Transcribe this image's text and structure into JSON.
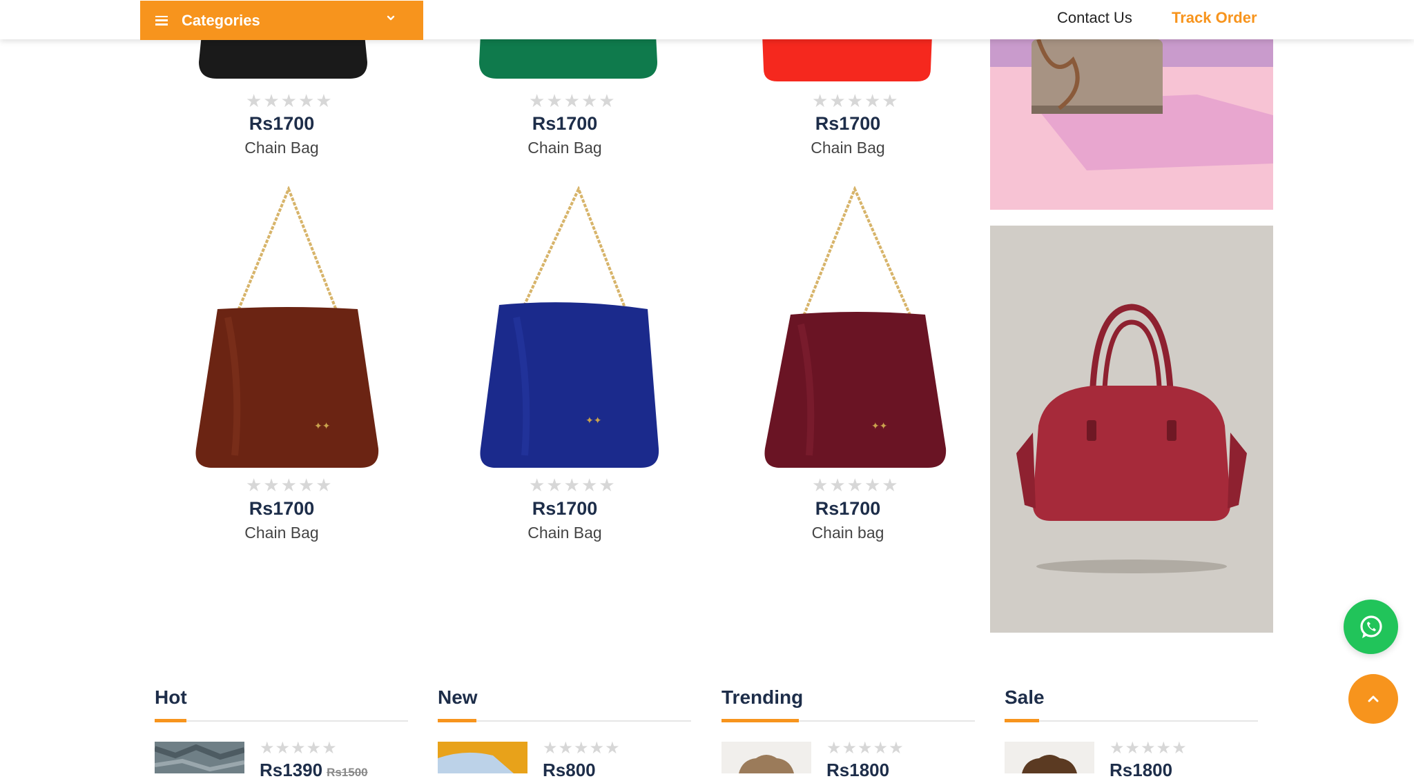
{
  "header": {
    "categories_label": "Categories",
    "contact_label": "Contact Us",
    "track_label": "Track Order"
  },
  "products_top": [
    {
      "price": "Rs1700",
      "name": "Chain Bag",
      "color": "#1a1a1a",
      "rating_stars": 0
    },
    {
      "price": "Rs1700",
      "name": "Chain Bag",
      "color": "#0f7a4c",
      "rating_stars": 0
    },
    {
      "price": "Rs1700",
      "name": "Chain Bag",
      "color": "#f5281e",
      "rating_stars": 0
    }
  ],
  "products_bottom": [
    {
      "price": "Rs1700",
      "name": "Chain Bag",
      "color": "#6b2413",
      "rating_stars": 0
    },
    {
      "price": "Rs1700",
      "name": "Chain Bag",
      "color": "#1b2a8c",
      "rating_stars": 0
    },
    {
      "price": "Rs1700",
      "name": "Chain bag",
      "color": "#6a1424",
      "rating_stars": 0
    }
  ],
  "banners": {
    "top_bg": "#f7c3d4",
    "bottom_bg": "#d1cdc7",
    "bottom_bag_color": "#a62a3a"
  },
  "sections": [
    {
      "title": "Hot",
      "price": "Rs1390",
      "old_price": "Rs1500"
    },
    {
      "title": "New",
      "price": "Rs800",
      "old_price": ""
    },
    {
      "title": "Trending",
      "price": "Rs1800",
      "old_price": ""
    },
    {
      "title": "Sale",
      "price": "Rs1800",
      "old_price": ""
    }
  ],
  "icons": {
    "menu": "menu-icon",
    "chevron": "chevron-down-icon",
    "whatsapp": "whatsapp-icon",
    "scroll_top": "chevron-up-icon",
    "star": "star-icon"
  },
  "colors": {
    "accent": "#f7941d",
    "price_text": "#1d2d49",
    "whatsapp": "#21c45a"
  }
}
